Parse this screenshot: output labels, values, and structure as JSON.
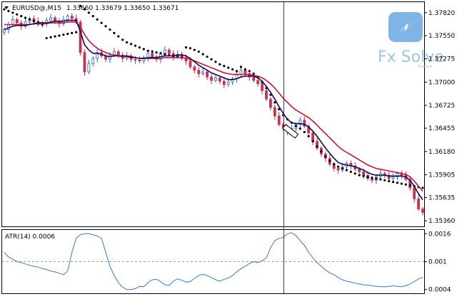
{
  "main_header": {
    "symbol": "EURUSD@,M15",
    "ohlc": "1.33660 1.33679 1.33650 1.33671"
  },
  "sub_header": {
    "label": "ATR(14) 0.0006"
  },
  "watermark": {
    "brand": "Fx Solve",
    "sub": "FxSolve"
  },
  "colors": {
    "ma_fast": "#0a0a5a",
    "ma_slow": "#c8143c",
    "atr": "#3a78d0",
    "bull": "#3264c8",
    "bear": "#c83250",
    "sar": "#000000",
    "vline": "#8b1a1a"
  },
  "chart_data": [
    {
      "type": "candlestick",
      "title": "EURUSD@,M15",
      "ylim": [
        1.3532,
        1.3792
      ],
      "yticks": [
        "1.37820",
        "1.37550",
        "1.37275",
        "1.37000",
        "1.36725",
        "1.36455",
        "1.36180",
        "1.35905",
        "1.35635",
        "1.35360"
      ],
      "bars": 100,
      "price_series": [
        1.3762,
        1.3768,
        1.3774,
        1.377,
        1.3766,
        1.3771,
        1.3775,
        1.3772,
        1.3768,
        1.377,
        1.3773,
        1.3776,
        1.3772,
        1.3769,
        1.3774,
        1.3778,
        1.3775,
        1.3771,
        1.3735,
        1.3712,
        1.3722,
        1.3728,
        1.3735,
        1.3731,
        1.3727,
        1.3732,
        1.3736,
        1.3732,
        1.3728,
        1.3731,
        1.3727,
        1.3726,
        1.3725,
        1.3729,
        1.3734,
        1.373,
        1.3727,
        1.3733,
        1.3738,
        1.3734,
        1.373,
        1.3733,
        1.3729,
        1.3725,
        1.3718,
        1.3714,
        1.371,
        1.3712,
        1.3706,
        1.3702,
        1.3705,
        1.3701,
        1.3697,
        1.37,
        1.3704,
        1.3709,
        1.3714,
        1.371,
        1.3706,
        1.3702,
        1.3698,
        1.369,
        1.368,
        1.367,
        1.366,
        1.365,
        1.3646,
        1.3642,
        1.3645,
        1.365,
        1.3655,
        1.3648,
        1.364,
        1.363,
        1.3622,
        1.3615,
        1.361,
        1.3603,
        1.3598,
        1.3596,
        1.36,
        1.3604,
        1.3601,
        1.3597,
        1.3594,
        1.359,
        1.3586,
        1.3584,
        1.3588,
        1.3592,
        1.359,
        1.3586,
        1.3588,
        1.3592,
        1.359,
        1.3585,
        1.3575,
        1.3562,
        1.355,
        1.3546
      ],
      "ma_fast": [
        1.3762,
        1.3764,
        1.3766,
        1.3767,
        1.3767,
        1.3767,
        1.3768,
        1.3769,
        1.377,
        1.377,
        1.377,
        1.3771,
        1.3772,
        1.3772,
        1.3772,
        1.3773,
        1.3773,
        1.3773,
        1.376,
        1.3744,
        1.3738,
        1.3734,
        1.3734,
        1.3733,
        1.3731,
        1.373,
        1.3731,
        1.3731,
        1.3731,
        1.3731,
        1.373,
        1.3729,
        1.3728,
        1.3728,
        1.3729,
        1.3729,
        1.3729,
        1.373,
        1.3731,
        1.3731,
        1.3731,
        1.3732,
        1.3732,
        1.3731,
        1.3728,
        1.3724,
        1.372,
        1.3717,
        1.3714,
        1.3711,
        1.3709,
        1.3707,
        1.3705,
        1.3703,
        1.3703,
        1.3704,
        1.3706,
        1.3707,
        1.3707,
        1.3707,
        1.3705,
        1.3701,
        1.3695,
        1.3688,
        1.368,
        1.3671,
        1.3663,
        1.3656,
        1.3652,
        1.3651,
        1.3651,
        1.365,
        1.3647,
        1.3642,
        1.3636,
        1.3629,
        1.3622,
        1.3616,
        1.361,
        1.3605,
        1.3603,
        1.3602,
        1.3601,
        1.36,
        1.3598,
        1.3596,
        1.3593,
        1.3591,
        1.359,
        1.359,
        1.359,
        1.3589,
        1.3589,
        1.3589,
        1.3589,
        1.3588,
        1.3584,
        1.3577,
        1.3568,
        1.3561
      ],
      "ma_slow": [
        1.3768,
        1.3768,
        1.3768,
        1.3768,
        1.3768,
        1.3768,
        1.3768,
        1.3769,
        1.3769,
        1.3769,
        1.3769,
        1.377,
        1.377,
        1.377,
        1.377,
        1.3771,
        1.3771,
        1.3771,
        1.3765,
        1.3756,
        1.3749,
        1.3744,
        1.374,
        1.3737,
        1.3735,
        1.3733,
        1.3732,
        1.3731,
        1.373,
        1.373,
        1.3729,
        1.3729,
        1.3728,
        1.3728,
        1.3728,
        1.3728,
        1.3728,
        1.3728,
        1.3729,
        1.3729,
        1.3729,
        1.3729,
        1.3729,
        1.3728,
        1.3727,
        1.3725,
        1.3723,
        1.3721,
        1.3719,
        1.3717,
        1.3715,
        1.3713,
        1.3711,
        1.371,
        1.3709,
        1.3709,
        1.3709,
        1.3709,
        1.3709,
        1.3708,
        1.3707,
        1.3705,
        1.3702,
        1.3698,
        1.3693,
        1.3687,
        1.3681,
        1.3676,
        1.3671,
        1.3667,
        1.3664,
        1.3661,
        1.3658,
        1.3654,
        1.3649,
        1.3644,
        1.3639,
        1.3634,
        1.3629,
        1.3624,
        1.362,
        1.3617,
        1.3614,
        1.3611,
        1.3608,
        1.3605,
        1.3602,
        1.36,
        1.3598,
        1.3597,
        1.3596,
        1.3595,
        1.3594,
        1.3593,
        1.3592,
        1.3591,
        1.3588,
        1.3583,
        1.3577,
        1.3571
      ],
      "sar": [
        1.3786,
        1.3784,
        1.3782,
        1.378,
        1.3778,
        1.3776,
        1.3774,
        1.3772,
        1.377,
        1.3768,
        1.3752,
        1.3753,
        1.3754,
        1.3755,
        1.3756,
        1.3757,
        1.3758,
        1.3759,
        1.379,
        1.3786,
        1.3782,
        1.3778,
        1.3774,
        1.377,
        1.3766,
        1.3762,
        1.3758,
        1.3754,
        1.375,
        1.3747,
        1.3745,
        1.3743,
        1.3741,
        1.3739,
        1.3737,
        1.3736,
        1.3735,
        1.3734,
        1.3733,
        1.3732,
        1.3731,
        1.373,
        1.3729,
        1.3741,
        1.374,
        1.3738,
        1.3736,
        1.3733,
        1.373,
        1.3727,
        1.3724,
        1.3721,
        1.3719,
        1.3717,
        1.3715,
        1.3713,
        1.3718,
        1.3715,
        1.3713,
        1.371,
        1.3706,
        1.37,
        1.3693,
        1.3685,
        1.3676,
        1.3668,
        1.3661,
        1.3656,
        1.3652,
        1.3648,
        1.3645,
        1.3641,
        1.3636,
        1.363,
        1.3624,
        1.3618,
        1.3612,
        1.3607,
        1.3603,
        1.36,
        1.3598,
        1.3596,
        1.3594,
        1.3592,
        1.359,
        1.3589,
        1.3588,
        1.3587,
        1.3586,
        1.3585,
        1.3584,
        1.3583,
        1.3582,
        1.3581,
        1.358,
        1.3579,
        1.3578,
        1.3577,
        1.3576,
        1.3575
      ]
    },
    {
      "type": "line",
      "title": "ATR(14) 0.0006",
      "ylim": [
        0.00035,
        0.00165
      ],
      "yticks": [
        "0.0016",
        "0.001",
        "0.0004"
      ],
      "values": [
        0.0012,
        0.0011,
        0.00105,
        0.001,
        0.00098,
        0.00095,
        0.00092,
        0.0009,
        0.00088,
        0.00085,
        0.00083,
        0.0008,
        0.00078,
        0.00075,
        0.00072,
        0.0008,
        0.0012,
        0.0015,
        0.00158,
        0.0016,
        0.0016,
        0.00158,
        0.00155,
        0.0015,
        0.0012,
        0.0009,
        0.0007,
        0.00055,
        0.00045,
        0.0004,
        0.0004,
        0.00042,
        0.00047,
        0.00046,
        0.00055,
        0.00061,
        0.00062,
        0.00057,
        0.0005,
        0.00049,
        0.00058,
        0.00063,
        0.0006,
        0.00056,
        0.00057,
        0.00064,
        0.0007,
        0.00073,
        0.0007,
        0.00066,
        0.00061,
        0.00058,
        0.00062,
        0.00065,
        0.0007,
        0.00078,
        0.00085,
        0.0009,
        0.00096,
        0.001,
        0.00098,
        0.00102,
        0.00108,
        0.0013,
        0.00145,
        0.0015,
        0.00152,
        0.0016,
        0.00162,
        0.00156,
        0.00145,
        0.00135,
        0.0012,
        0.00108,
        0.00098,
        0.0009,
        0.00082,
        0.00076,
        0.00072,
        0.00066,
        0.00061,
        0.00058,
        0.00056,
        0.00054,
        0.00052,
        0.0005,
        0.0005,
        0.00048,
        0.00047,
        0.00046,
        0.00046,
        0.00047,
        0.00048,
        0.00047,
        0.00046,
        0.00048,
        0.00052,
        0.00057,
        0.00063,
        0.00066
      ]
    }
  ]
}
